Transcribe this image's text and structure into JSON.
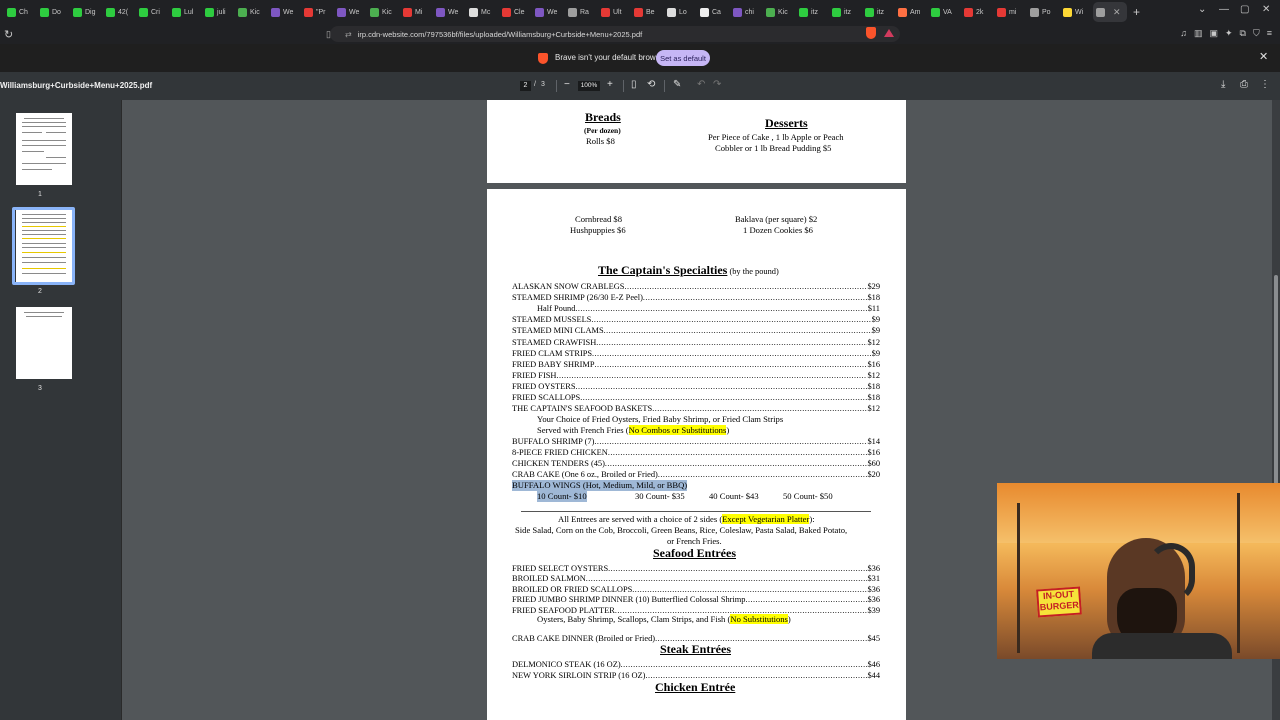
{
  "browser": {
    "tabs": [
      {
        "label": "Ch",
        "color": "#2ecc40"
      },
      {
        "label": "Do",
        "color": "#2ecc40"
      },
      {
        "label": "Dig",
        "color": "#2ecc40"
      },
      {
        "label": "42(",
        "color": "#2ecc40"
      },
      {
        "label": "Cri",
        "color": "#2ecc40"
      },
      {
        "label": "Lul",
        "color": "#2ecc40"
      },
      {
        "label": "juli",
        "color": "#2ecc40"
      },
      {
        "label": "Kic",
        "color": "#4caf50"
      },
      {
        "label": "We",
        "color": "#7e57c2"
      },
      {
        "label": "\"Pr",
        "color": "#e53935"
      },
      {
        "label": "We",
        "color": "#7e57c2"
      },
      {
        "label": "Kic",
        "color": "#4caf50"
      },
      {
        "label": "Mi",
        "color": "#e53935"
      },
      {
        "label": "We",
        "color": "#7e57c2"
      },
      {
        "label": "Mc",
        "color": "#dddddd"
      },
      {
        "label": "Cle",
        "color": "#e53935"
      },
      {
        "label": "We",
        "color": "#7e57c2"
      },
      {
        "label": "Ra",
        "color": "#9e9e9e"
      },
      {
        "label": "Ult",
        "color": "#e53935"
      },
      {
        "label": "Be",
        "color": "#e53935"
      },
      {
        "label": "Lo",
        "color": "#dddddd"
      },
      {
        "label": "Ca",
        "color": "#eeeeee"
      },
      {
        "label": "chi",
        "color": "#7e57c2"
      },
      {
        "label": "Kic",
        "color": "#4caf50"
      },
      {
        "label": "itz",
        "color": "#2ecc40"
      },
      {
        "label": "itz",
        "color": "#2ecc40"
      },
      {
        "label": "itz",
        "color": "#2ecc40"
      },
      {
        "label": "Am",
        "color": "#ff7043"
      },
      {
        "label": "VA",
        "color": "#2ecc40"
      },
      {
        "label": "2k",
        "color": "#e53935"
      },
      {
        "label": "mi",
        "color": "#e53935"
      },
      {
        "label": "Po",
        "color": "#9e9e9e"
      },
      {
        "label": "Wi",
        "color": "#fdd835"
      },
      {
        "label": "",
        "color": "#9e9e9e",
        "active": true
      }
    ],
    "url": "irp.cdn-website.com/797536bf/files/uploaded/Williamsburg+Curbside+Menu+2025.pdf"
  },
  "infobar": {
    "message": "Brave isn't your default browser",
    "button": "Set as default"
  },
  "pdf_toolbar": {
    "title": "Williamsburg+Curbside+Menu+2025.pdf",
    "current_page": "2",
    "separator": "/",
    "total_pages": "3",
    "zoom": "100%"
  },
  "thumbnails": [
    {
      "number": "1"
    },
    {
      "number": "2",
      "selected": true
    },
    {
      "number": "3"
    }
  ],
  "page1": {
    "breads_title": "Breads",
    "breads_sub": "(Per dozen)",
    "breads_item": "Rolls $8",
    "desserts_title": "Desserts",
    "desserts_line1": "Per Piece of Cake , 1 lb Apple or Peach",
    "desserts_line2": "Cobbler or 1 lb Bread Pudding    $5"
  },
  "page2": {
    "cornbread": "Cornbread $8",
    "hushpuppies": "Hushpuppies $6",
    "baklava": "Baklava (per square) $2",
    "cookies": "1 Dozen Cookies $6",
    "specialties_title": "The Captain's Specialties",
    "specialties_sub": " (by the pound)",
    "specialties": [
      {
        "name": "ALASKAN SNOW CRABLEGS",
        "price": "$29"
      },
      {
        "name": "STEAMED SHRIMP (26/30 E-Z Peel)",
        "price": "$18"
      },
      {
        "name": "Half Pound",
        "price": "$11",
        "indent": true
      },
      {
        "name": "STEAMED MUSSELS",
        "price": "$9"
      },
      {
        "name": "STEAMED MINI CLAMS",
        "price": "$9"
      },
      {
        "name": "STEAMED CRAWFISH",
        "price": "$12"
      },
      {
        "name": "FRIED CLAM STRIPS",
        "price": "$9"
      },
      {
        "name": "FRIED BABY SHRIMP",
        "price": "$16"
      },
      {
        "name": "FRIED FISH",
        "price": "$12"
      },
      {
        "name": "FRIED OYSTERS",
        "price": "$18"
      },
      {
        "name": "FRIED SCALLOPS",
        "price": "$18"
      },
      {
        "name": "THE CAPTAIN'S SEAFOOD BASKETS",
        "price": "$12"
      }
    ],
    "baskets_note1": "Your Choice of Fried Oysters, Fried Baby Shrimp, or Fried Clam Strips",
    "baskets_note2_pre": "Served with French Fries (",
    "baskets_note2_hl": "No Combos or Substitutions",
    "baskets_note2_post": ")",
    "specialties2": [
      {
        "name": "BUFFALO SHRIMP (7)",
        "price": "$14"
      },
      {
        "name": "8-PIECE FRIED CHICKEN",
        "price": "$16"
      },
      {
        "name": "CHICKEN TENDERS (45)",
        "price": "$60"
      },
      {
        "name": "CRAB CAKE (One 6 oz., Broiled or Fried)",
        "price": "$20"
      }
    ],
    "wings_label": "BUFFALO WINGS (Hot, Medium, Mild, or BBQ)",
    "wings_counts": [
      "10 Count- $10",
      "30 Count- $35",
      "40 Count- $43",
      "50 Count- $50"
    ],
    "entrees_note1_pre": "All Entrees are served with a choice of 2 sides (",
    "entrees_note1_hl": "Except Vegetarian Platter",
    "entrees_note1_post": "):",
    "entrees_note2": "Side Salad, Corn on the Cob, Broccoli, Green Beans, Rice, Coleslaw, Pasta Salad, Baked Potato,",
    "entrees_note3": "or French Fries.",
    "seafood_title": "Seafood Entrées",
    "seafood": [
      {
        "name": "FRIED SELECT OYSTERS",
        "price": "$36"
      },
      {
        "name": "BROILED SALMON",
        "price": "$31"
      },
      {
        "name": "BROILED OR FRIED SCALLOPS",
        "price": "$36"
      },
      {
        "name": "FRIED JUMBO SHRIMP DINNER (10) Butterflied Colossal Shrimp",
        "price": "$36"
      },
      {
        "name": "FRIED SEAFOOD PLATTER",
        "price": "$39"
      }
    ],
    "platter_note_pre": "Oysters, Baby Shrimp, Scallops, Clam Strips, and Fish (",
    "platter_note_hl": "No Substitutions",
    "platter_note_post": ")",
    "crab_dinner": {
      "name": "CRAB CAKE DINNER (Broiled or Fried)",
      "price": "$45"
    },
    "steak_title": "Steak Entrées",
    "steaks": [
      {
        "name": "DELMONICO STEAK (16 OZ)",
        "price": "$46"
      },
      {
        "name": "NEW YORK SIRLOIN STRIP (16 OZ)",
        "price": "$44"
      }
    ],
    "chicken_title": "Chicken Entrée"
  },
  "webcam": {
    "sign_text": "IN-OUT BURGER"
  }
}
